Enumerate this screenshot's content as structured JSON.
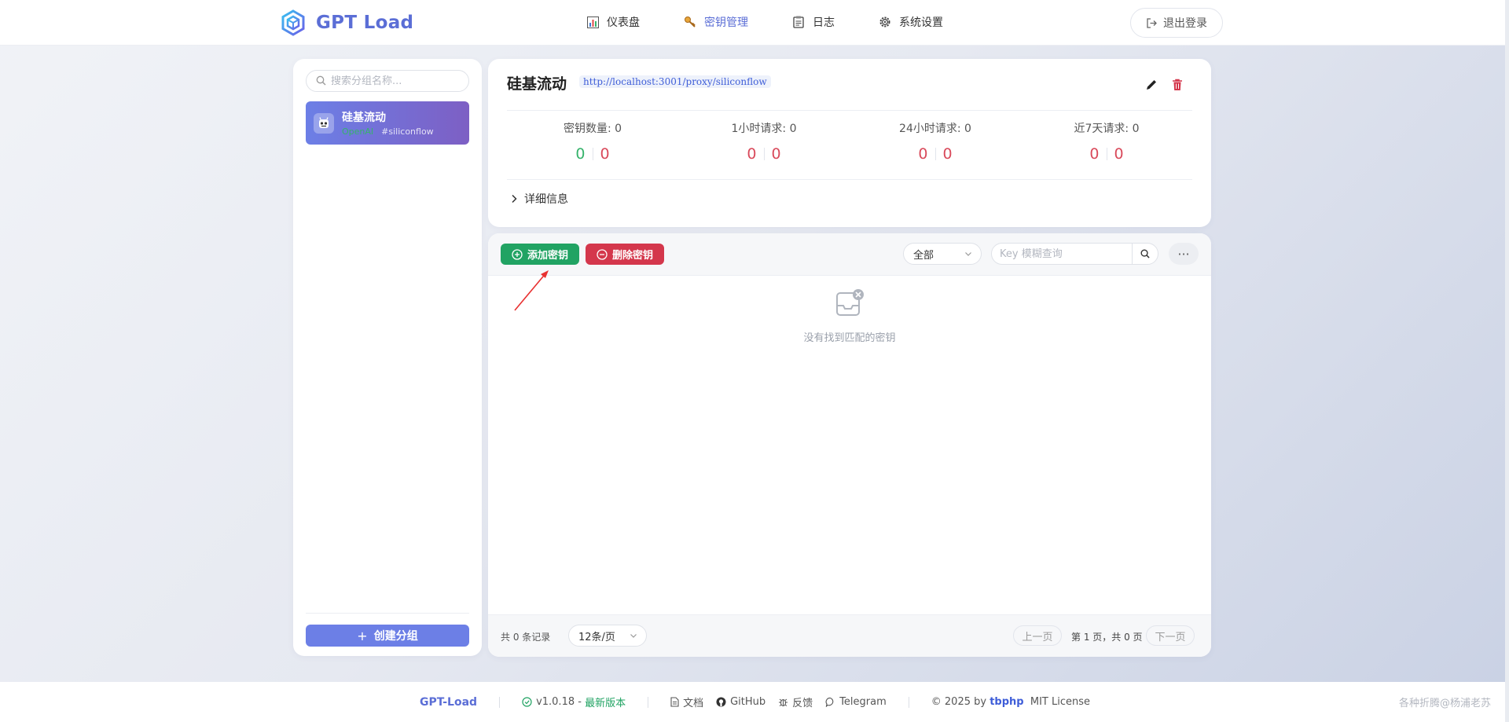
{
  "header": {
    "brand": "GPT Load",
    "nav": [
      {
        "label": "仪表盘",
        "icon": "bar-chart-icon"
      },
      {
        "label": "密钥管理",
        "icon": "key-icon"
      },
      {
        "label": "日志",
        "icon": "clipboard-icon"
      },
      {
        "label": "系统设置",
        "icon": "gear-icon"
      }
    ],
    "logout_label": "退出登录"
  },
  "sidebar": {
    "search_placeholder": "搜索分组名称...",
    "groups": [
      {
        "name": "硅基流动",
        "tag": "OpenAI",
        "slug": "#siliconflow"
      }
    ],
    "create_label": "创建分组"
  },
  "info": {
    "title": "硅基流动",
    "url": "http://localhost:3001/proxy/siliconflow",
    "stats": [
      {
        "label": "密钥数量: 0",
        "a": "0",
        "b": "0",
        "a_color": "green"
      },
      {
        "label": "1小时请求: 0",
        "a": "0",
        "b": "0",
        "a_color": "red"
      },
      {
        "label": "24小时请求: 0",
        "a": "0",
        "b": "0",
        "a_color": "red"
      },
      {
        "label": "近7天请求: 0",
        "a": "0",
        "b": "0",
        "a_color": "red"
      }
    ],
    "details_label": "详细信息"
  },
  "keys": {
    "add_label": "添加密钥",
    "delete_label": "删除密钥",
    "status_filter": "全部",
    "search_placeholder": "Key 模糊查询",
    "more_label": "···",
    "empty_text": "没有找到匹配的密钥",
    "total_label": "共 0 条记录",
    "page_size": "12条/页",
    "prev_label": "上一页",
    "page_info": "第 1 页，共 0 页",
    "next_label": "下一页"
  },
  "footer": {
    "brand": "GPT-Load",
    "version": "v1.0.18",
    "latest": "最新版本",
    "links": [
      "文档",
      "GitHub",
      "反馈",
      "Telegram"
    ],
    "copyright_prefix": "© 2025 by",
    "author": "tbphp",
    "license": "MIT License"
  },
  "watermark": "各种折腾@杨浦老苏",
  "colors": {
    "accent": "#5b6ed6",
    "success": "#21a363",
    "danger": "#d4374c"
  }
}
